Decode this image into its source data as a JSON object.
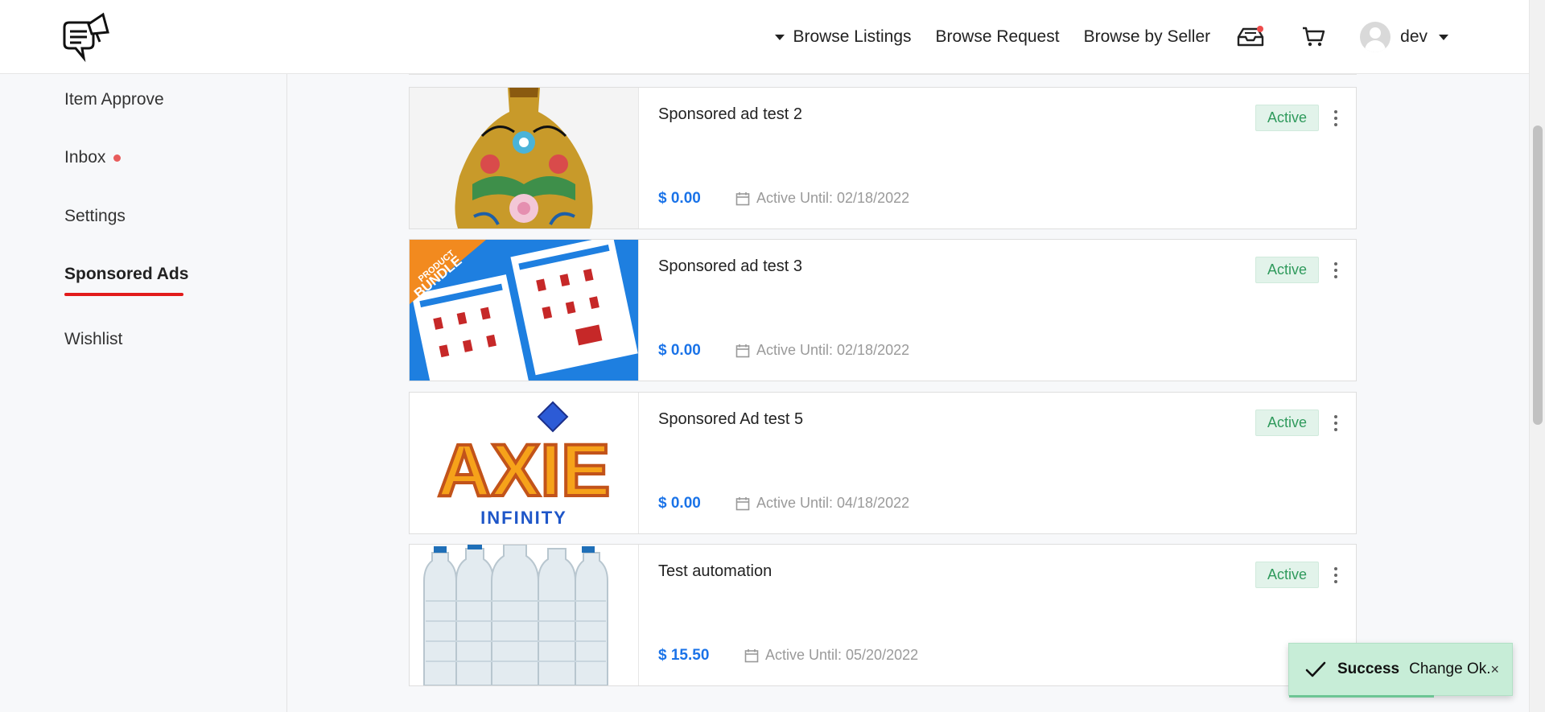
{
  "header": {
    "nav": {
      "browse_listings": "Browse Listings",
      "browse_request": "Browse Request",
      "browse_by_seller": "Browse by Seller"
    },
    "user_name": "dev",
    "icons": [
      "logo-megaphone-chat-icon",
      "inbox-tray-icon",
      "cart-icon",
      "avatar-icon",
      "chevron-down-icon"
    ]
  },
  "sidebar": {
    "items": [
      {
        "label": "Item Approve"
      },
      {
        "label": "Inbox"
      },
      {
        "label": "Settings"
      },
      {
        "label": "Sponsored Ads",
        "active": true
      },
      {
        "label": "Wishlist"
      }
    ]
  },
  "ads": [
    {
      "title": "Sponsored ad test 2",
      "price": "$ 0.00",
      "until": "Active Until: 02/18/2022",
      "status": "Active",
      "image": "cloisonne-vase"
    },
    {
      "title": "Sponsored ad test 3",
      "price": "$ 0.00",
      "until": "Active Until: 02/18/2022",
      "status": "Active",
      "image": "product-bundle-drills"
    },
    {
      "title": "Sponsored Ad test 5",
      "price": "$ 0.00",
      "until": "Active Until: 04/18/2022",
      "status": "Active",
      "image": "axie-infinity-logo"
    },
    {
      "title": "Test automation",
      "price": "$ 15.50",
      "until": "Active Until: 05/20/2022",
      "status": "Active",
      "image": "water-bottles"
    }
  ],
  "thumb_text": {
    "bundle_line1": "PRODUCT",
    "bundle_line2": "BUNDLE",
    "axie": "AXIE",
    "infinity": "INFINITY"
  },
  "toast": {
    "title": "Success",
    "message": "Change Ok.",
    "close": "×"
  },
  "colors": {
    "accent_blue": "#1a73e8",
    "active_underline": "#e21b1b",
    "badge_bg": "#e2f3ea",
    "badge_text": "#2f9a5c",
    "toast_bg": "#c7edd7"
  }
}
